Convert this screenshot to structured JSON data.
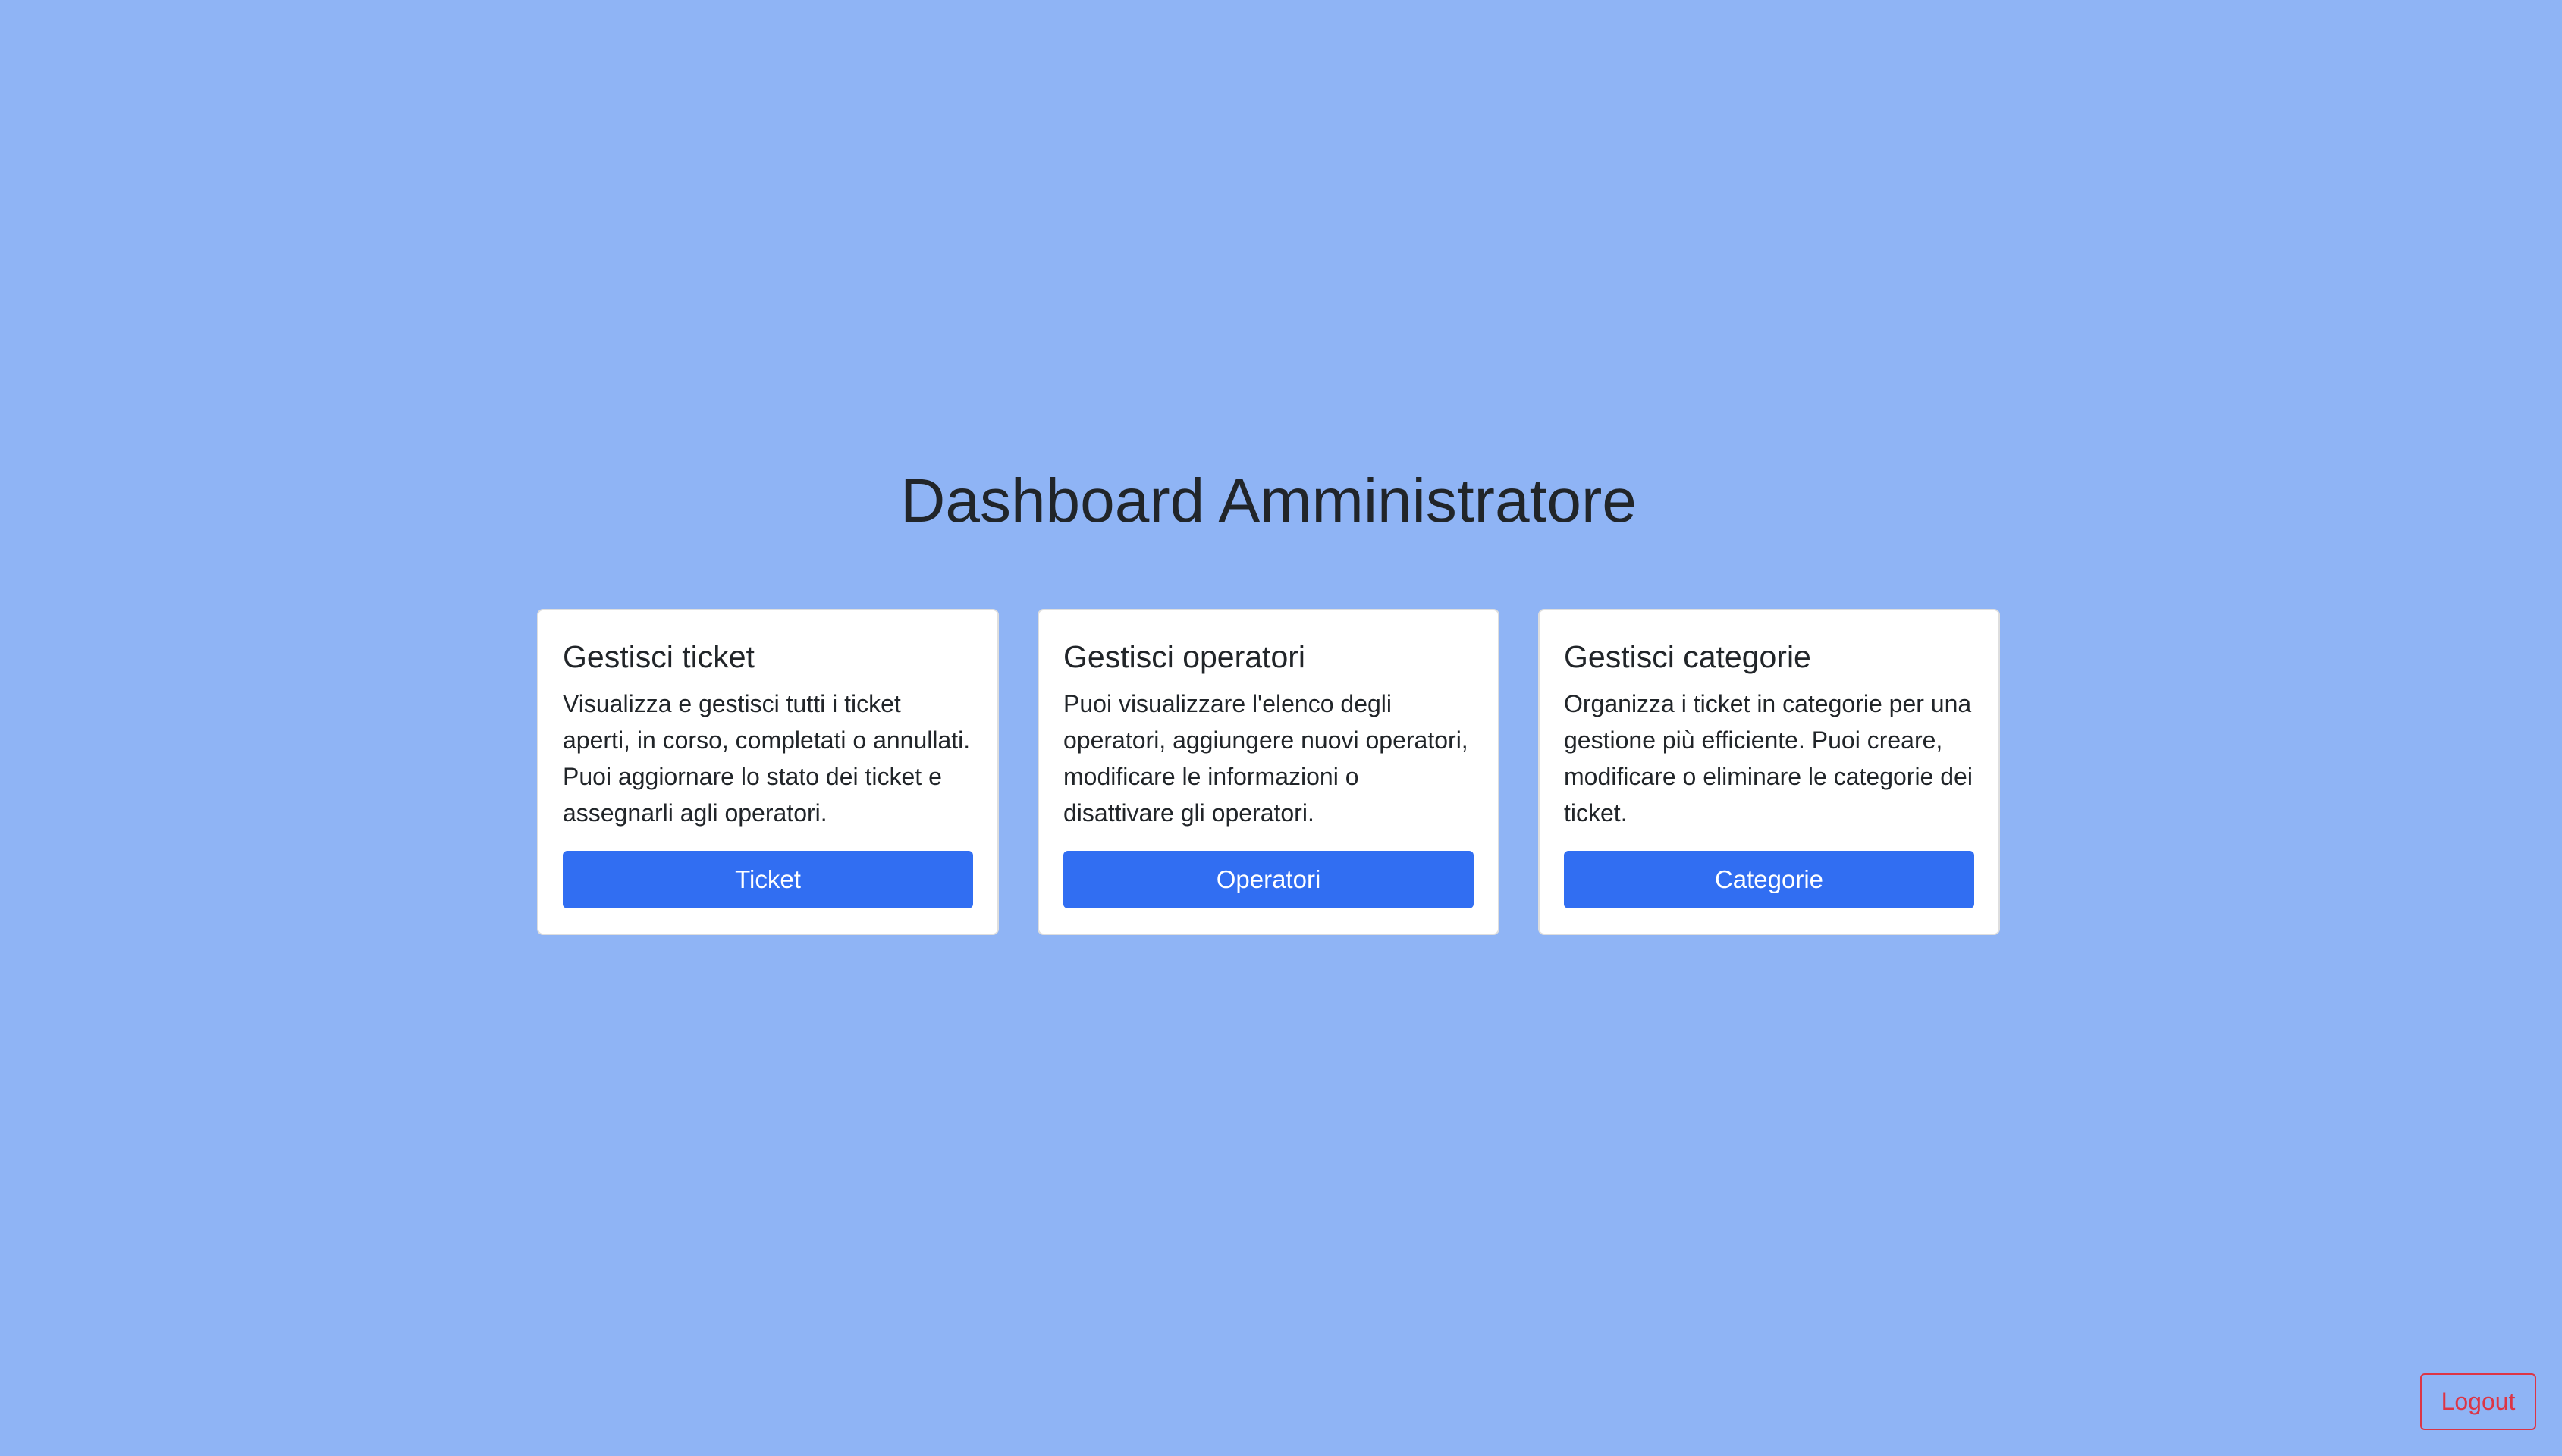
{
  "page": {
    "title": "Dashboard Amministratore"
  },
  "cards": [
    {
      "title": "Gestisci ticket",
      "text": "Visualizza e gestisci tutti i ticket aperti, in corso, completati o annullati. Puoi aggiornare lo stato dei ticket e assegnarli agli operatori.",
      "button_label": "Ticket"
    },
    {
      "title": "Gestisci operatori",
      "text": "Puoi visualizzare l'elenco degli operatori, aggiungere nuovi operatori, modificare le informazioni o disattivare gli operatori.",
      "button_label": "Operatori"
    },
    {
      "title": "Gestisci categorie",
      "text": "Organizza i ticket in categorie per una gestione più efficiente. Puoi creare, modificare o eliminare le categorie dei ticket.",
      "button_label": "Categorie"
    }
  ],
  "logout": {
    "label": "Logout"
  },
  "colors": {
    "background": "#8fb4f5",
    "primary": "#316ef2",
    "danger": "#dc3545",
    "text": "#212529"
  }
}
